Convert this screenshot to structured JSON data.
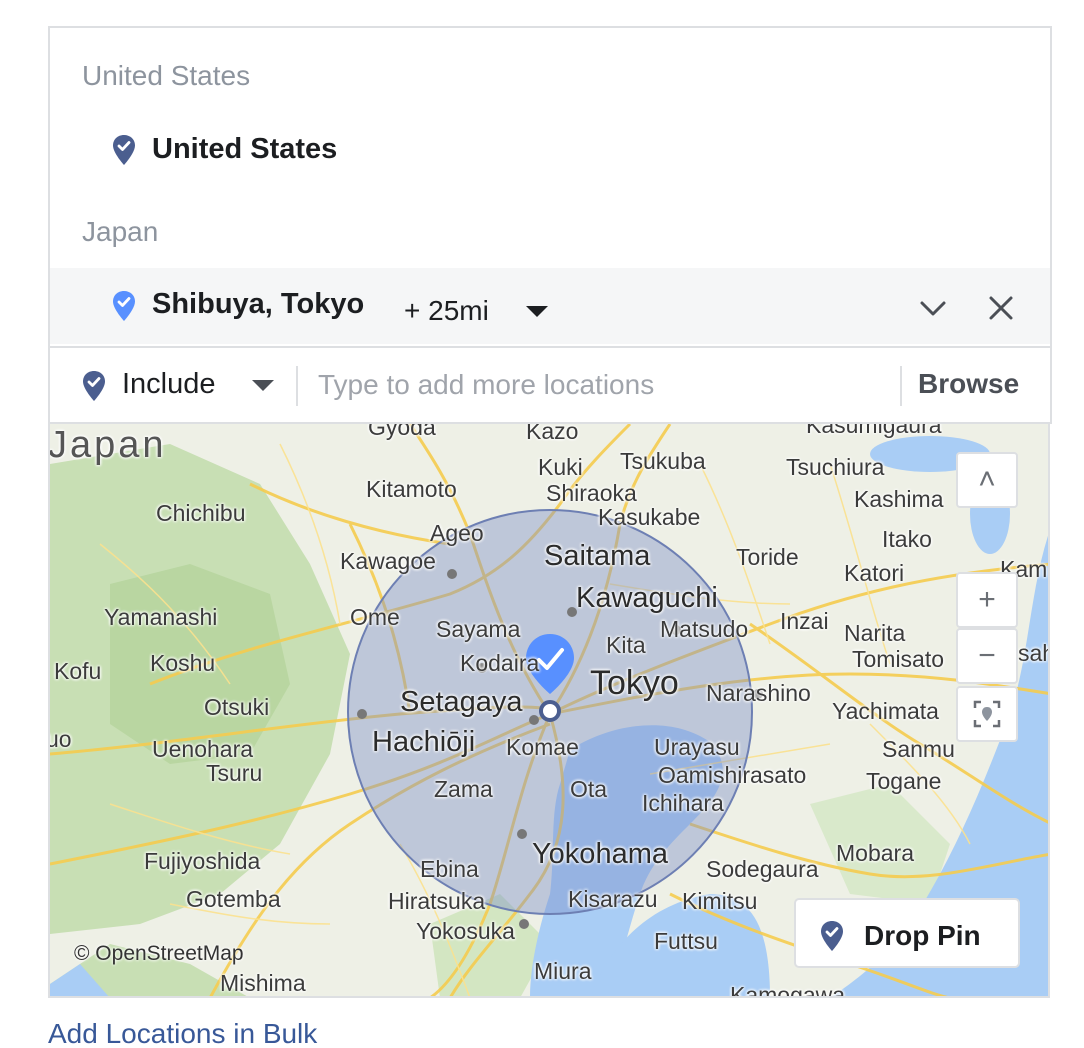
{
  "colors": {
    "pin_dark": "#4b5e8f",
    "pin_light": "#5890ff",
    "link": "#385898",
    "radius_fill": "#7b8fc7",
    "water": "#a9cdf5",
    "land": "#eef0e6",
    "forest": "#c8dfb4"
  },
  "groups": [
    {
      "label": "United States",
      "location": {
        "name": "United States",
        "icon": "location-pin-icon"
      }
    },
    {
      "label": "Japan",
      "location": {
        "name": "Shibuya, Tokyo",
        "radius": "+ 25mi",
        "icon": "location-pin-icon"
      }
    }
  ],
  "input_bar": {
    "mode": "Include",
    "placeholder": "Type to add more locations",
    "browse": "Browse"
  },
  "map": {
    "place_labels": [
      "Japan",
      "Gyoda",
      "Kazo",
      "Kasumigaura",
      "Kuki",
      "Tsukuba",
      "Tsuchiura",
      "Kitamoto",
      "Shiraoka",
      "Kashima",
      "Chichibu",
      "Ageo",
      "Kasukabe",
      "Itako",
      "Kawagoe",
      "Saitama",
      "Toride",
      "Katori",
      "Kam",
      "Yamanashi",
      "Ome",
      "Sayama",
      "Kawaguchi",
      "Matsudo",
      "Inzai",
      "Narita",
      "Kita",
      "Kofu",
      "Koshu",
      "Kodaira",
      "Tokyo",
      "Tomisato",
      "Narashino",
      "sah",
      "Otsuki",
      "Setagaya",
      "Yachimata",
      "uo",
      "Uenohara",
      "Hachiōji",
      "Komae",
      "Urayasu",
      "Sanmu",
      "Tsuru",
      "Oamishirasato",
      "Togane",
      "Zama",
      "Ota",
      "Ichihara",
      "Fujiyoshida",
      "Yokohama",
      "Mobara",
      "Ebina",
      "Sodegaura",
      "Gotemba",
      "Hiratsuka",
      "Kisarazu",
      "Kimitsu",
      "Yokosuka",
      "Futtsu",
      "Mishima",
      "Miura",
      "Kamogawa"
    ],
    "attribution": "© OpenStreetMap",
    "controls": {
      "up": "˄",
      "zoom_in": "+",
      "zoom_out": "−"
    },
    "drop_pin": "Drop Pin"
  },
  "bulk_link": "Add Locations in Bulk"
}
